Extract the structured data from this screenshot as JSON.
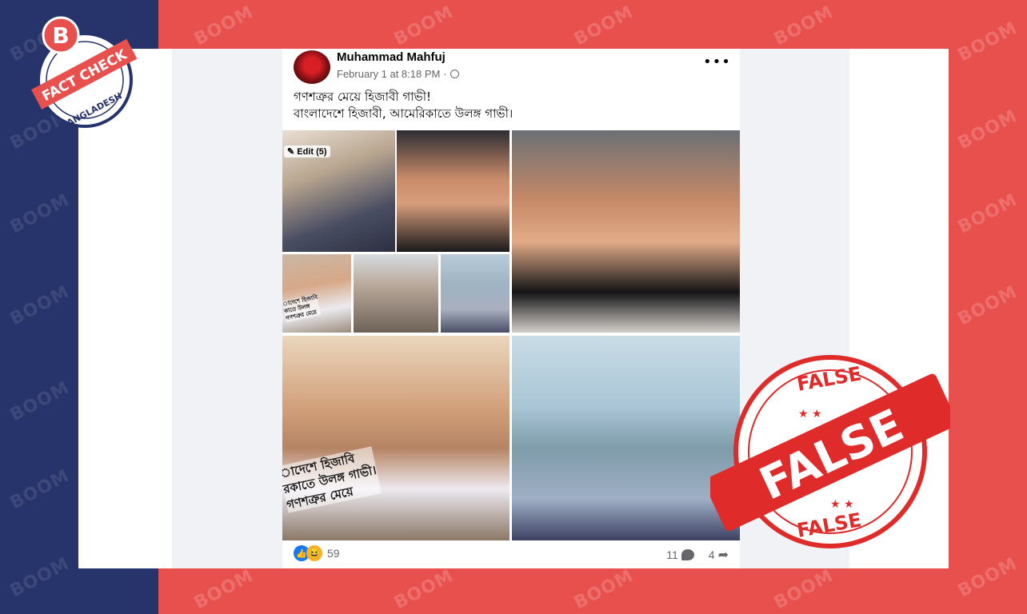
{
  "watermark": "BOOM",
  "logo": {
    "letter": "B",
    "ribbon": "FACT CHECK",
    "country": "BANGLADESH"
  },
  "post": {
    "author": "Muhammad Mahfuj",
    "timestamp": "February 1 at 8:18 PM",
    "separator": "·",
    "caption_line1": "গণশত্রুর মেয়ে হিজাবী গাভী!",
    "caption_line2": "বাংলাদেশে হিজাবী, আমেরিকাতে উলঙ্গ গাভী।",
    "edit_badge": "✎ Edit (5)",
    "overlay_small": [
      "াদেশে হিজাবি",
      "কাতে উলঙ্গ",
      "গণশত্রুর মেয়ে"
    ],
    "overlay_big": [
      "াদেশে হিজাবি",
      "রকাতে উলঙ্গ গাভী।",
      "গণশত্রুর মেয়ে"
    ],
    "reaction_count": "59",
    "comment_count": "11",
    "share_count": "4"
  },
  "stamp": {
    "text": "FALSE"
  },
  "colors": {
    "navy": "#27346b",
    "red": "#e8504d",
    "fb_blue": "#1877f2",
    "stamp_red": "#e02b2b"
  }
}
